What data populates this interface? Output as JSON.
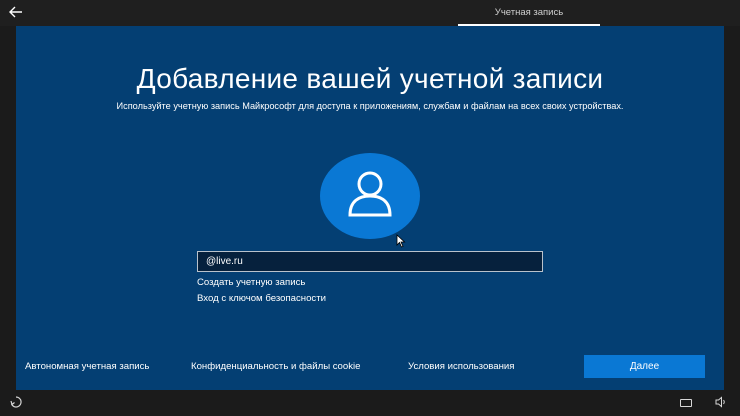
{
  "header": {
    "back_icon": "arrow-left-icon",
    "active_tab": "Учетная запись"
  },
  "main": {
    "title": "Добавление вашей учетной записи",
    "subtitle": "Используйте учетную запись Майкрософт для доступа к приложениям, службам и файлам на всех своих устройствах.",
    "avatar_icon": "user-icon",
    "email_value": "@live.ru",
    "links": {
      "create_account": "Создать учетную запись",
      "security_key": "Вход с ключом безопасности"
    }
  },
  "footer": {
    "offline_account": "Автономная учетная запись",
    "privacy": "Конфиденциальность и файлы cookie",
    "terms": "Условия использования",
    "next_label": "Далее"
  },
  "taskbar": {
    "ease_icon": "ease-of-access-icon",
    "keyboard_icon": "keyboard-icon",
    "volume_icon": "volume-icon"
  },
  "colors": {
    "panel": "#043f73",
    "accent": "#0a78d4",
    "bar": "#1f1f1f"
  }
}
